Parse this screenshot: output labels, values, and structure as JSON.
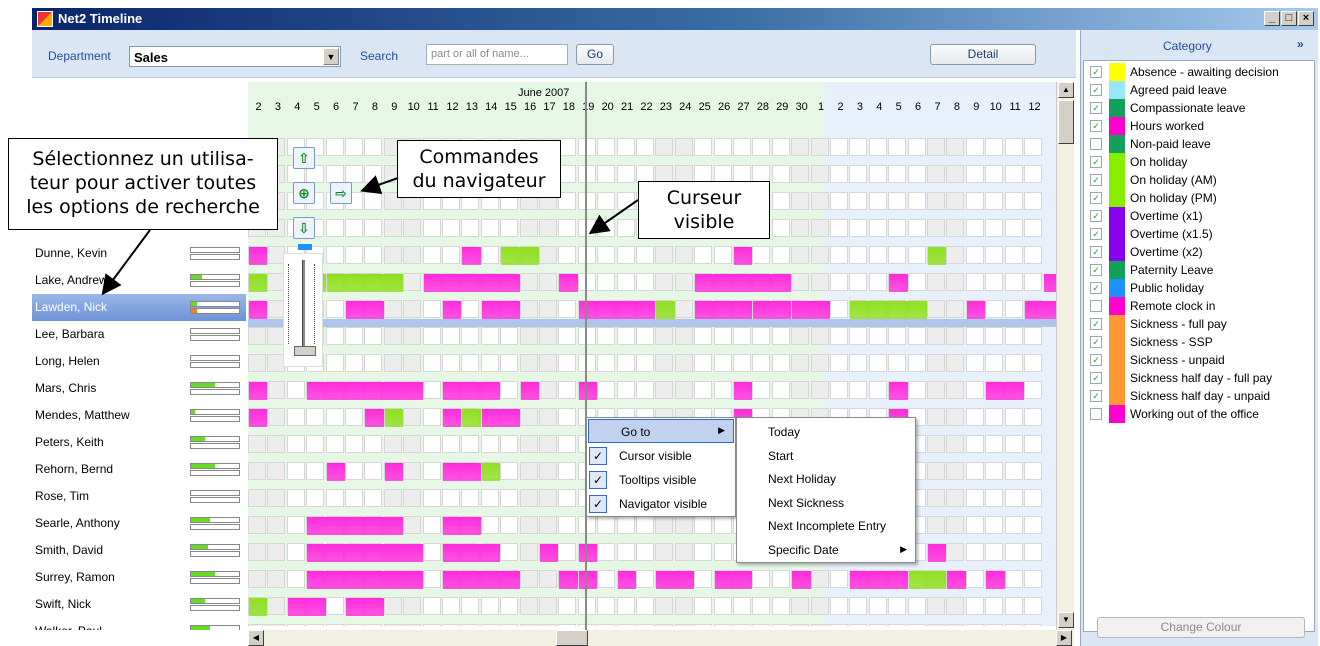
{
  "window": {
    "title": "Net2 Timeline",
    "btn_min": "_",
    "btn_max": "□",
    "btn_close": "×"
  },
  "toolbar": {
    "department_label": "Department",
    "department_value": "Sales",
    "search_label": "Search",
    "search_placeholder": "part or all of name...",
    "go_label": "Go",
    "detail_label": "Detail"
  },
  "timeline": {
    "month_label": "June 2007",
    "days": [
      "2",
      "3",
      "4",
      "5",
      "6",
      "7",
      "8",
      "9",
      "10",
      "11",
      "12",
      "13",
      "14",
      "15",
      "16",
      "17",
      "18",
      "19",
      "20",
      "21",
      "22",
      "23",
      "24",
      "25",
      "26",
      "27",
      "28",
      "29",
      "30",
      "1",
      "2",
      "3",
      "4",
      "5",
      "6",
      "7",
      "8",
      "9",
      "10",
      "11",
      "12"
    ],
    "weekend_days": [
      "2",
      "3",
      "9",
      "10",
      "16",
      "17",
      "23",
      "24",
      "30",
      "1",
      "7",
      "8"
    ]
  },
  "users": [
    {
      "name": "Dunne, Kevin",
      "bar": 0.0
    },
    {
      "name": "Lake, Andrew",
      "bar": 0.22
    },
    {
      "name": "Lawden, Nick",
      "bar": 0.12,
      "selected": true
    },
    {
      "name": "Lee, Barbara",
      "bar": 0.0
    },
    {
      "name": "Long, Helen",
      "bar": 0.0
    },
    {
      "name": "Mars, Chris",
      "bar": 0.5
    },
    {
      "name": "Mendes, Matthew",
      "bar": 0.08
    },
    {
      "name": "Peters, Keith",
      "bar": 0.3
    },
    {
      "name": "Rehorn, Bernd",
      "bar": 0.5
    },
    {
      "name": "Rose, Tim",
      "bar": 0.0
    },
    {
      "name": "Searle, Anthony",
      "bar": 0.4
    },
    {
      "name": "Smith, David",
      "bar": 0.35
    },
    {
      "name": "Surrey, Ramon",
      "bar": 0.5
    },
    {
      "name": "Swift, Nick",
      "bar": 0.3
    },
    {
      "name": "Walker, Paul",
      "bar": 0.4
    }
  ],
  "callouts": {
    "select_user": "Sélectionnez un utilisa-\nteur pour activer toutes\nles options de recherche",
    "nav_controls": "Commandes\ndu navigateur",
    "cursor": "Curseur\nvisible"
  },
  "context_menu": {
    "goto": "Go to",
    "cursor_visible": "Cursor visible",
    "tooltips_visible": "Tooltips visible",
    "navigator_visible": "Navigator visible",
    "submenu": [
      "Today",
      "Start",
      "Next Holiday",
      "Next Sickness",
      "Next Incomplete Entry",
      "Specific Date"
    ]
  },
  "category_panel": {
    "title": "Category",
    "expand_icon": "»",
    "change_colour": "Change Colour",
    "items": [
      {
        "label": "Absence - awaiting decision",
        "color": "#ffff00",
        "checked": true
      },
      {
        "label": "Agreed paid leave",
        "color": "#99e6ff",
        "checked": true
      },
      {
        "label": "Compassionate leave",
        "color": "#12a05a",
        "checked": true
      },
      {
        "label": "Hours worked",
        "color": "#ff00d0",
        "checked": true
      },
      {
        "label": "Non-paid leave",
        "color": "#12a05a",
        "checked": false
      },
      {
        "label": "On holiday",
        "color": "#88ee00",
        "checked": true
      },
      {
        "label": "On holiday (AM)",
        "color": "#88ee00",
        "checked": true
      },
      {
        "label": "On holiday (PM)",
        "color": "#88ee00",
        "checked": true
      },
      {
        "label": "Overtime (x1)",
        "color": "#8800ee",
        "checked": true
      },
      {
        "label": "Overtime (x1.5)",
        "color": "#8800ee",
        "checked": true
      },
      {
        "label": "Overtime (x2)",
        "color": "#8800ee",
        "checked": true
      },
      {
        "label": "Paternity Leave",
        "color": "#12a05a",
        "checked": true
      },
      {
        "label": "Public holiday",
        "color": "#1e90ff",
        "checked": true
      },
      {
        "label": "Remote clock in",
        "color": "#ff00d0",
        "checked": false
      },
      {
        "label": "Sickness - full pay",
        "color": "#ff9933",
        "checked": true
      },
      {
        "label": "Sickness - SSP",
        "color": "#ff9933",
        "checked": true
      },
      {
        "label": "Sickness - unpaid",
        "color": "#ff9933",
        "checked": true
      },
      {
        "label": "Sickness half day - full pay",
        "color": "#ff9933",
        "checked": true
      },
      {
        "label": "Sickness half day - unpaid",
        "color": "#ff9933",
        "checked": true
      },
      {
        "label": "Working out of the office",
        "color": "#ff00d0",
        "checked": false
      }
    ]
  }
}
